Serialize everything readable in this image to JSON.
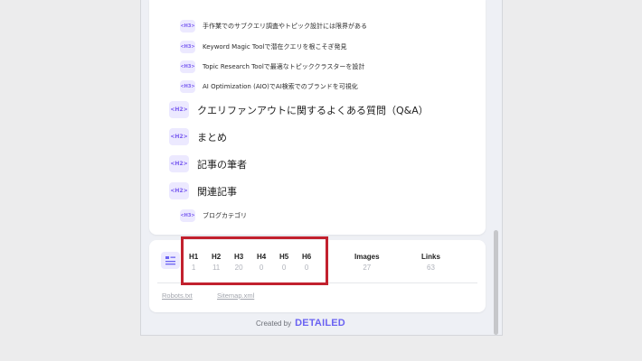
{
  "outline": {
    "items": [
      {
        "level": "<H3>",
        "text": "手作業でのサブクエリ調査やトピック設計には限界がある"
      },
      {
        "level": "<H3>",
        "text": "Keyword Magic Toolで潜在クエリを根こそぎ発見"
      },
      {
        "level": "<H3>",
        "text": "Topic Research Toolで最適なトピッククラスターを設計"
      },
      {
        "level": "<H3>",
        "text": "AI Optimization (AIO)でAI検索でのブランドを可視化"
      },
      {
        "level": "<H2>",
        "text": "クエリファンアウトに関するよくある質問（Q&A）"
      },
      {
        "level": "<H2>",
        "text": "まとめ"
      },
      {
        "level": "<H2>",
        "text": "記事の筆者"
      },
      {
        "level": "<H2>",
        "text": "関連記事"
      },
      {
        "level": "<H3>",
        "text": "ブログカテゴリ"
      }
    ]
  },
  "stats": {
    "h1": {
      "label": "H1",
      "value": "1"
    },
    "h2": {
      "label": "H2",
      "value": "11"
    },
    "h3": {
      "label": "H3",
      "value": "20"
    },
    "h4": {
      "label": "H4",
      "value": "0"
    },
    "h5": {
      "label": "H5",
      "value": "0"
    },
    "h6": {
      "label": "H6",
      "value": "0"
    },
    "images": {
      "label": "Images",
      "value": "27"
    },
    "links": {
      "label": "Links",
      "value": "63"
    }
  },
  "footer_links": {
    "robots": "Robots.txt",
    "sitemap": "Sitemap.xml"
  },
  "credit": {
    "prefix": "Created by",
    "brand": "DETAILED"
  },
  "colors": {
    "accent": "#6b63f2",
    "badge_bg": "#ece9ff",
    "highlight": "#c2212e"
  },
  "icons": {
    "headings": "heading-list-icon"
  }
}
